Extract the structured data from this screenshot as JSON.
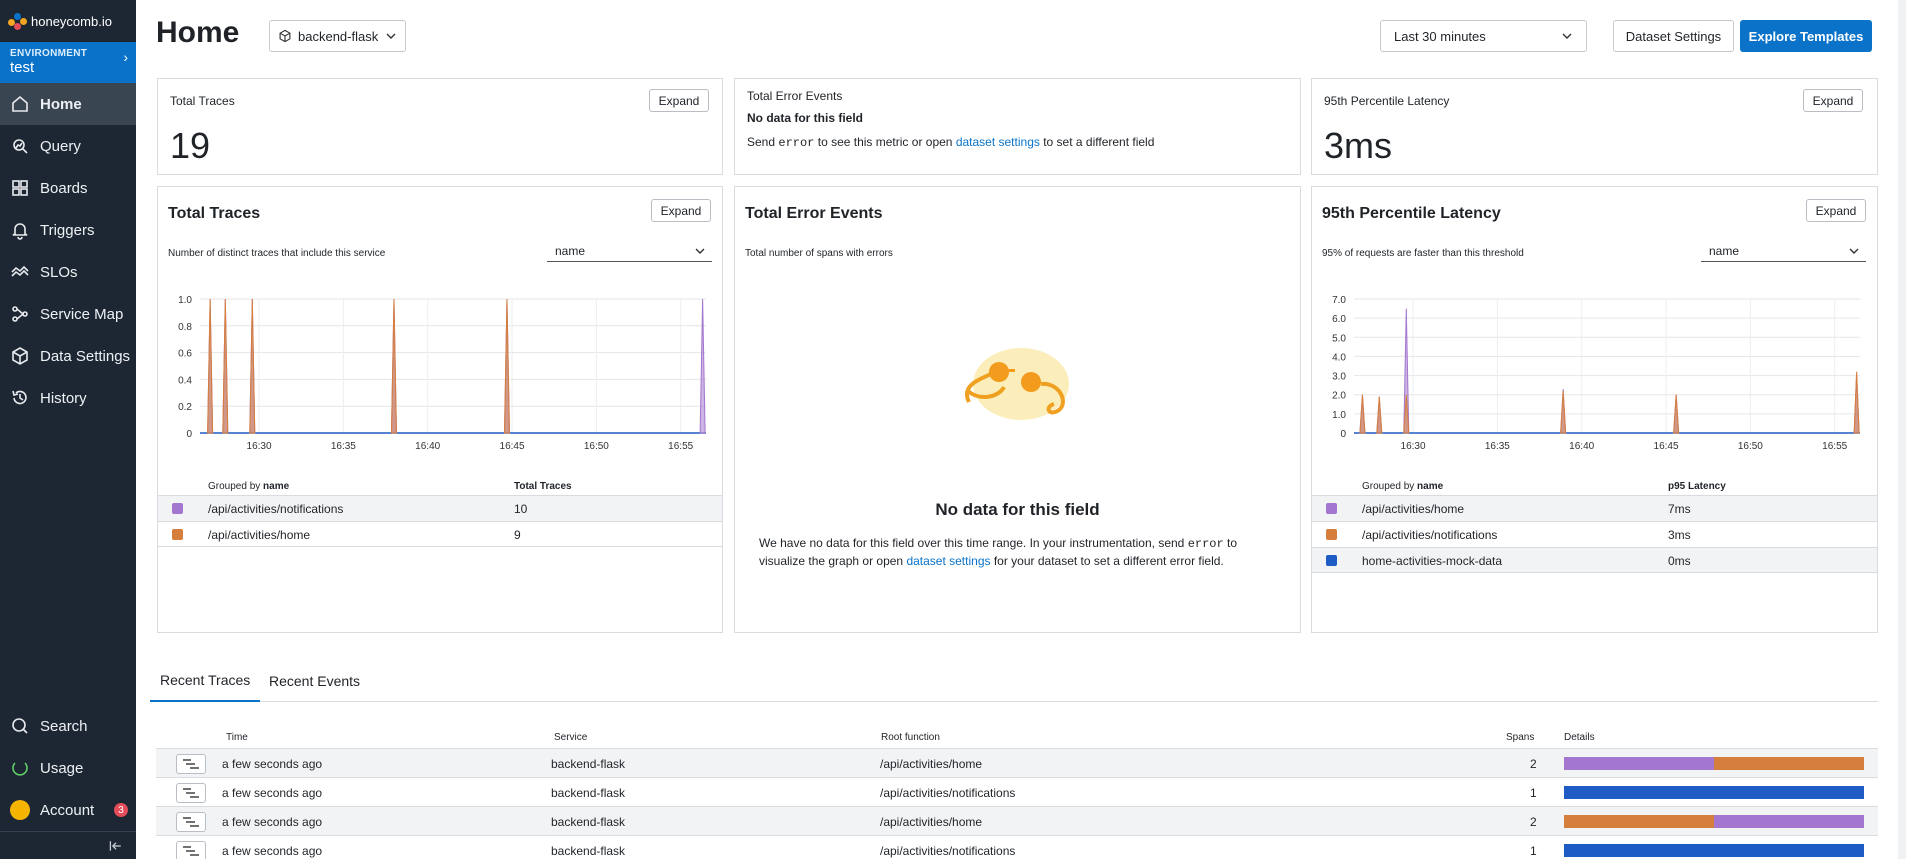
{
  "brand": {
    "name": "honeycomb.io"
  },
  "environment": {
    "label": "ENVIRONMENT",
    "value": "test"
  },
  "nav": {
    "items": [
      {
        "label": "Home",
        "icon": "home-icon"
      },
      {
        "label": "Query",
        "icon": "query-icon"
      },
      {
        "label": "Boards",
        "icon": "boards-icon"
      },
      {
        "label": "Triggers",
        "icon": "bell-icon"
      },
      {
        "label": "SLOs",
        "icon": "slo-icon"
      },
      {
        "label": "Service Map",
        "icon": "service-map-icon"
      },
      {
        "label": "Data Settings",
        "icon": "cube-icon"
      },
      {
        "label": "History",
        "icon": "history-icon"
      }
    ],
    "bottom": [
      {
        "label": "Search",
        "icon": "search-icon"
      },
      {
        "label": "Usage",
        "icon": "usage-icon"
      },
      {
        "label": "Account",
        "icon": "avatar",
        "badge": "3"
      }
    ]
  },
  "header": {
    "title": "Home",
    "dataset": "backend-flask",
    "time_range": "Last 30 minutes",
    "dataset_settings": "Dataset Settings",
    "explore_templates": "Explore Templates"
  },
  "summary": {
    "traces": {
      "title": "Total Traces",
      "value": "19",
      "expand": "Expand"
    },
    "errors": {
      "title": "Total Error Events",
      "no_data": "No data for this field",
      "msg_send": "Send",
      "msg_field": "error",
      "msg_mid": "to see this metric or open",
      "msg_link": "dataset settings",
      "msg_end": "to set a different field"
    },
    "latency": {
      "title": "95th Percentile Latency",
      "value": "3ms",
      "expand": "Expand"
    }
  },
  "panels": {
    "traces": {
      "title": "Total Traces",
      "expand": "Expand",
      "subtitle": "Number of distinct traces that include this service",
      "group_select": "name",
      "table": {
        "grouped_by": "Grouped by",
        "grouped_field": "name",
        "value_header": "Total Traces",
        "rows": [
          {
            "name": "/api/activities/notifications",
            "value": "10",
            "color": "#a376cf"
          },
          {
            "name": "/api/activities/home",
            "value": "9",
            "color": "#d67f3c"
          }
        ]
      }
    },
    "errors": {
      "title": "Total Error Events",
      "subtitle": "Total number of spans with errors",
      "empty_title": "No data for this field",
      "empty_1": "We have no data for this field over this time range. In your instrumentation, send",
      "empty_field": "error",
      "empty_2": "to",
      "empty_3": "visualize the graph or open",
      "empty_link": "dataset settings",
      "empty_4": "for your dataset to set a different error field."
    },
    "latency": {
      "title": "95th Percentile Latency",
      "expand": "Expand",
      "subtitle": "95% of requests are faster than this threshold",
      "group_select": "name",
      "table": {
        "grouped_by": "Grouped by",
        "grouped_field": "name",
        "value_header": "p95 Latency",
        "rows": [
          {
            "name": "/api/activities/home",
            "value": "7ms",
            "color": "#a376cf"
          },
          {
            "name": "/api/activities/notifications",
            "value": "3ms",
            "color": "#d67f3c"
          },
          {
            "name": "home-activities-mock-data",
            "value": "0ms",
            "color": "#1f5bc4"
          }
        ]
      }
    }
  },
  "chart_data": [
    {
      "type": "line",
      "x_ticks": [
        "16:30",
        "16:35",
        "16:40",
        "16:45",
        "16:50",
        "16:55"
      ],
      "y_ticks": [
        "0",
        "0.2",
        "0.4",
        "0.6",
        "0.8",
        "1.0"
      ],
      "ylim": [
        0,
        1.0
      ],
      "xlim_minutes": [
        26.5,
        56.5
      ],
      "series": [
        {
          "name": "/api/activities/notifications",
          "color": "#a376cf",
          "spikes": [
            [
              27.1,
              1.0
            ],
            [
              28.0,
              1.0
            ],
            [
              29.6,
              1.0
            ],
            [
              38.0,
              1.0
            ],
            [
              44.7,
              1.0
            ],
            [
              56.3,
              1.0
            ]
          ]
        },
        {
          "name": "/api/activities/home",
          "color": "#d67f3c",
          "spikes": [
            [
              27.1,
              1.0
            ],
            [
              28.0,
              1.0
            ],
            [
              29.6,
              1.0
            ],
            [
              38.0,
              1.0
            ],
            [
              44.7,
              1.0
            ]
          ]
        }
      ]
    },
    {
      "type": "line",
      "x_ticks": [
        "16:30",
        "16:35",
        "16:40",
        "16:45",
        "16:50",
        "16:55"
      ],
      "y_ticks": [
        "0",
        "1.0",
        "2.0",
        "3.0",
        "4.0",
        "5.0",
        "6.0",
        "7.0"
      ],
      "ylim": [
        0,
        7.0
      ],
      "xlim_minutes": [
        26.5,
        56.5
      ],
      "series": [
        {
          "name": "/api/activities/home",
          "color": "#a376cf",
          "spikes": [
            [
              27.0,
              2.0
            ],
            [
              28.0,
              1.9
            ],
            [
              29.6,
              6.5
            ],
            [
              38.9,
              2.3
            ],
            [
              45.6,
              2.0
            ],
            [
              56.3,
              3.1
            ]
          ]
        },
        {
          "name": "/api/activities/notifications",
          "color": "#d67f3c",
          "spikes": [
            [
              27.0,
              2.0
            ],
            [
              28.0,
              1.9
            ],
            [
              29.6,
              2.0
            ],
            [
              38.9,
              2.2
            ],
            [
              45.6,
              2.0
            ],
            [
              56.3,
              3.2
            ]
          ]
        },
        {
          "name": "home-activities-mock-data",
          "color": "#1f5bc4",
          "spikes": []
        }
      ]
    }
  ],
  "tabs": [
    "Recent Traces",
    "Recent Events"
  ],
  "traces_table": {
    "headers": {
      "time": "Time",
      "service": "Service",
      "root": "Root function",
      "spans": "Spans",
      "details": "Details"
    },
    "rows": [
      {
        "time": "a few seconds ago",
        "service": "backend-flask",
        "root": "/api/activities/home",
        "spans": "2",
        "bars": [
          {
            "frac": 0.5,
            "color": "#a376cf"
          },
          {
            "frac": 0.5,
            "color": "#d67f3c"
          }
        ]
      },
      {
        "time": "a few seconds ago",
        "service": "backend-flask",
        "root": "/api/activities/notifications",
        "spans": "1",
        "bars": [
          {
            "frac": 1.0,
            "color": "#1f5bc4"
          }
        ]
      },
      {
        "time": "a few seconds ago",
        "service": "backend-flask",
        "root": "/api/activities/home",
        "spans": "2",
        "bars": [
          {
            "frac": 0.5,
            "color": "#d67f3c"
          },
          {
            "frac": 0.5,
            "color": "#a376cf"
          }
        ]
      },
      {
        "time": "a few seconds ago",
        "service": "backend-flask",
        "root": "/api/activities/notifications",
        "spans": "1",
        "bars": [
          {
            "frac": 1.0,
            "color": "#1f5bc4"
          }
        ]
      }
    ]
  }
}
